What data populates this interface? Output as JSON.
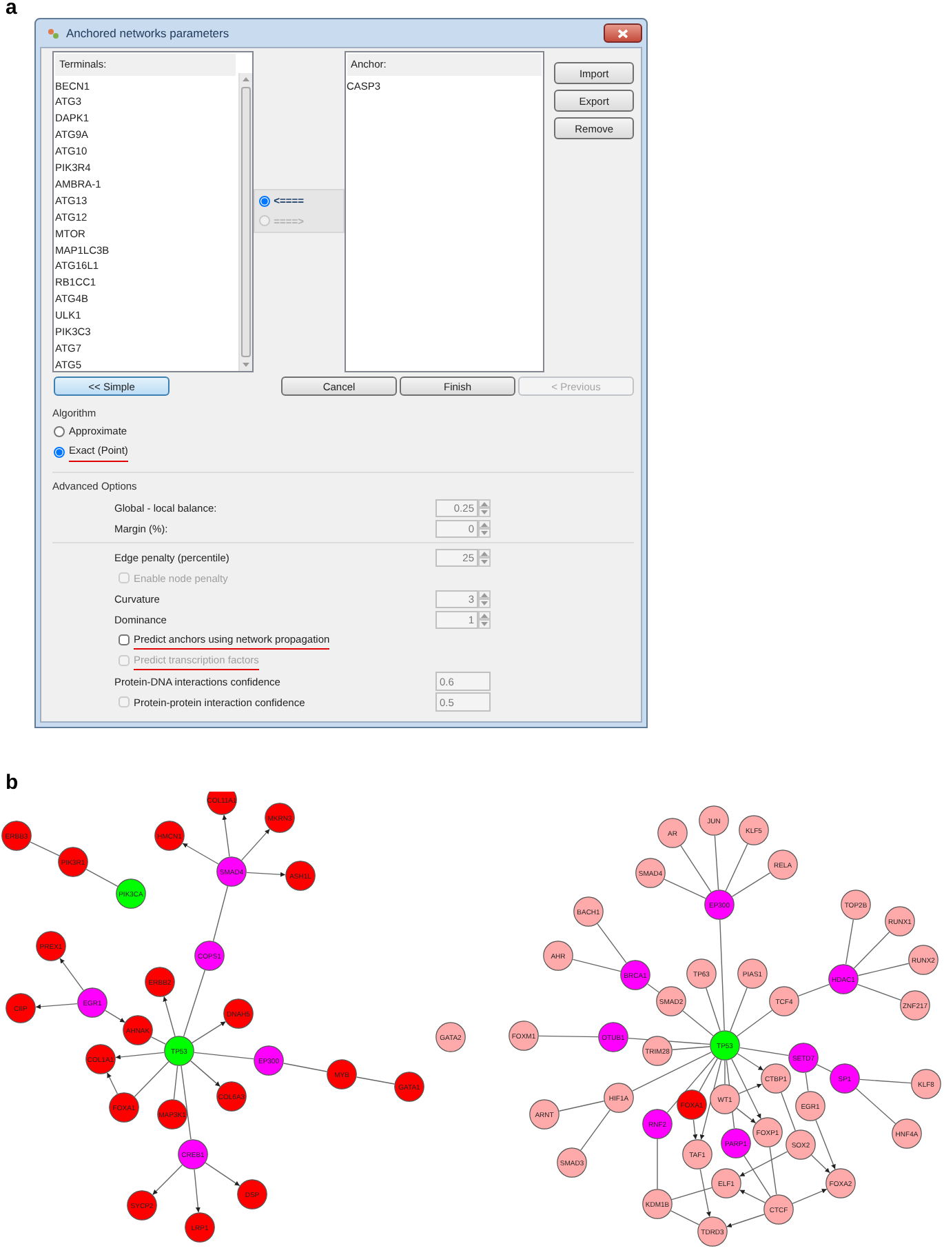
{
  "figure_labels": [
    "a",
    "b"
  ],
  "dialog": {
    "title": "Anchored networks parameters",
    "terminals": {
      "header": "Terminals:",
      "items": [
        "BECN1",
        "ATG3",
        "DAPK1",
        "ATG9A",
        "ATG10",
        "PIK3R4",
        "AMBRA-1",
        "ATG13",
        "ATG12",
        "MTOR",
        "MAP1LC3B",
        "ATG16L1",
        "RB1CC1",
        "ATG4B",
        "ULK1",
        "PIK3C3",
        "ATG7",
        "ATG5"
      ]
    },
    "direction": [
      {
        "label": "<====",
        "selected": true,
        "disabled": false
      },
      {
        "label": "====>",
        "selected": false,
        "disabled": true
      }
    ],
    "anchor": {
      "header": "Anchor:",
      "items": [
        "CASP3"
      ]
    },
    "side_buttons": [
      "Import",
      "Export",
      "Remove"
    ],
    "nav_buttons": [
      {
        "label": "<< Simple",
        "focused": true,
        "disabled": false
      },
      {
        "label": "Cancel",
        "focused": false,
        "disabled": false
      },
      {
        "label": "Finish",
        "focused": false,
        "disabled": false
      },
      {
        "label": "< Previous",
        "focused": false,
        "disabled": true
      }
    ],
    "algorithm": {
      "title": "Algorithm",
      "options": [
        {
          "label": "Approximate",
          "selected": false,
          "underlined": false
        },
        {
          "label": "Exact (Point)",
          "selected": true,
          "underlined": true
        }
      ]
    },
    "advanced": {
      "title": "Advanced Options",
      "groups": [
        [
          {
            "kind": "spinner",
            "label": "Global - local balance:",
            "value": "0.25",
            "disabled": true
          },
          {
            "kind": "spinner",
            "label": "Margin (%):",
            "value": "0",
            "disabled": true
          }
        ],
        [
          {
            "kind": "spinner",
            "label": "Edge penalty (percentile)",
            "value": "25",
            "disabled": true
          },
          {
            "kind": "checkbox",
            "label": "Enable node penalty",
            "checked": false,
            "disabled": true,
            "underlined": false
          },
          {
            "kind": "spinner",
            "label": "Curvature",
            "value": "3",
            "disabled": true
          },
          {
            "kind": "spinner",
            "label": "Dominance",
            "value": "1",
            "disabled": true
          },
          {
            "kind": "checkbox",
            "label": "Predict anchors using network propagation",
            "checked": false,
            "disabled": false,
            "underlined": true
          },
          {
            "kind": "checkbox",
            "label": "Predict transcription factors",
            "checked": false,
            "disabled": true,
            "underlined": true
          },
          {
            "kind": "field",
            "label": "Protein-DNA interactions confidence",
            "value": "0.6",
            "disabled": true
          },
          {
            "kind": "checkbox_field",
            "label": "Protein-protein interaction confidence",
            "value": "0.5",
            "checked": false,
            "disabled": true
          }
        ]
      ]
    }
  },
  "networks": [
    {
      "nodes": [
        {
          "label": "ERBB3",
          "color": "#ff0000"
        },
        {
          "label": "PIK3R1",
          "color": "#ff0000"
        },
        {
          "label": "PIK3CA",
          "color": "#00ff00"
        },
        {
          "label": "COL11A1",
          "color": "#ff0000"
        },
        {
          "label": "MKRN3",
          "color": "#ff0000"
        },
        {
          "label": "HMCN1",
          "color": "#ff0000"
        },
        {
          "label": "SMAD4",
          "color": "#ff00ff"
        },
        {
          "label": "ASH1L",
          "color": "#ff0000"
        },
        {
          "label": "COPS1",
          "color": "#ff00ff"
        },
        {
          "label": "PREX1",
          "color": "#ff0000"
        },
        {
          "label": "CIIP",
          "color": "#ff0000"
        },
        {
          "label": "EGR1",
          "color": "#ff00ff"
        },
        {
          "label": "ERBB2",
          "color": "#ff0000"
        },
        {
          "label": "AHNAK",
          "color": "#ff0000"
        },
        {
          "label": "DNAH5",
          "color": "#ff0000"
        },
        {
          "label": "TP53",
          "color": "#00ff00"
        },
        {
          "label": "COL1A1",
          "color": "#ff0000"
        },
        {
          "label": "EP300",
          "color": "#ff00ff"
        },
        {
          "label": "MYB",
          "color": "#ff0000"
        },
        {
          "label": "GATA1",
          "color": "#ff0000"
        },
        {
          "label": "GATA2",
          "color": "#ffaaaa"
        },
        {
          "label": "FOXA1",
          "color": "#ff0000"
        },
        {
          "label": "MAP3K1",
          "color": "#ff0000"
        },
        {
          "label": "COL6A3",
          "color": "#ff0000"
        },
        {
          "label": "CREB1",
          "color": "#ff00ff"
        },
        {
          "label": "SYCP2",
          "color": "#ff0000"
        },
        {
          "label": "LRP1",
          "color": "#ff0000"
        },
        {
          "label": "DSP",
          "color": "#ff0000"
        }
      ]
    },
    {
      "nodes": [
        {
          "label": "AR",
          "color": "#ffaaaa"
        },
        {
          "label": "JUN",
          "color": "#ffaaaa"
        },
        {
          "label": "KLF5",
          "color": "#ffaaaa"
        },
        {
          "label": "SMAD4",
          "color": "#ffaaaa"
        },
        {
          "label": "RELA",
          "color": "#ffaaaa"
        },
        {
          "label": "EP300",
          "color": "#ff00ff"
        },
        {
          "label": "BACH1",
          "color": "#ffaaaa"
        },
        {
          "label": "TOP2B",
          "color": "#ffaaaa"
        },
        {
          "label": "RUNX1",
          "color": "#ffaaaa"
        },
        {
          "label": "RUNX2",
          "color": "#ffaaaa"
        },
        {
          "label": "AHR",
          "color": "#ffaaaa"
        },
        {
          "label": "BRCA1",
          "color": "#ff00ff"
        },
        {
          "label": "TP63",
          "color": "#ffaaaa"
        },
        {
          "label": "PIAS1",
          "color": "#ffaaaa"
        },
        {
          "label": "HDAC1",
          "color": "#ff00ff"
        },
        {
          "label": "SMAD2",
          "color": "#ffaaaa"
        },
        {
          "label": "TCF4",
          "color": "#ffaaaa"
        },
        {
          "label": "ZNF217",
          "color": "#ffaaaa"
        },
        {
          "label": "FOXM1",
          "color": "#ffaaaa"
        },
        {
          "label": "OTUB1",
          "color": "#ff00ff"
        },
        {
          "label": "TRIM28",
          "color": "#ffaaaa"
        },
        {
          "label": "TP53",
          "color": "#00ff00"
        },
        {
          "label": "SETD7",
          "color": "#ff00ff"
        },
        {
          "label": "SP1",
          "color": "#ff00ff"
        },
        {
          "label": "KLF8",
          "color": "#ffaaaa"
        },
        {
          "label": "CTBP1",
          "color": "#ffaaaa"
        },
        {
          "label": "HIF1A",
          "color": "#ffaaaa"
        },
        {
          "label": "FOXA1",
          "color": "#ff0000"
        },
        {
          "label": "WT1",
          "color": "#ffaaaa"
        },
        {
          "label": "EGR1",
          "color": "#ffaaaa"
        },
        {
          "label": "ARNT",
          "color": "#ffaaaa"
        },
        {
          "label": "RNF2",
          "color": "#ff00ff"
        },
        {
          "label": "HNF4A",
          "color": "#ffaaaa"
        },
        {
          "label": "FOXP1",
          "color": "#ffaaaa"
        },
        {
          "label": "SOX2",
          "color": "#ffaaaa"
        },
        {
          "label": "PARP1",
          "color": "#ff00ff"
        },
        {
          "label": "TAF1",
          "color": "#ffaaaa"
        },
        {
          "label": "SMAD3",
          "color": "#ffaaaa"
        },
        {
          "label": "ELF1",
          "color": "#ffaaaa"
        },
        {
          "label": "FOXA2",
          "color": "#ffaaaa"
        },
        {
          "label": "KDM1B",
          "color": "#ffaaaa"
        },
        {
          "label": "CTCF",
          "color": "#ffaaaa"
        },
        {
          "label": "TDRD3",
          "color": "#ffaaaa"
        }
      ]
    }
  ]
}
